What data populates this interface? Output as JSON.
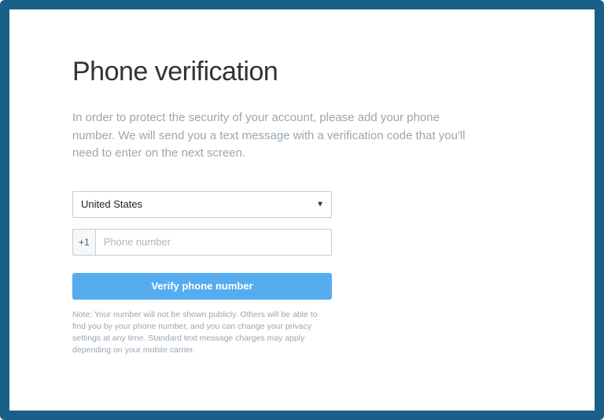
{
  "title": "Phone verification",
  "description": "In order to protect the security of your account, please add your phone number. We will send you a text message with a verification code that you'll need to enter on the next screen.",
  "form": {
    "country_selected": "United States",
    "phone_prefix": "+1",
    "phone_placeholder": "Phone number",
    "verify_button": "Verify phone number"
  },
  "note": "Note: Your number will not be shown publicly. Others will be able to find you by your phone number, and you can change your privacy settings at any time. Standard text message charges may apply depending on your mobile carrier.",
  "colors": {
    "border": "#1a5e8a",
    "primary": "#55acee",
    "muted": "#9aa6b0"
  }
}
